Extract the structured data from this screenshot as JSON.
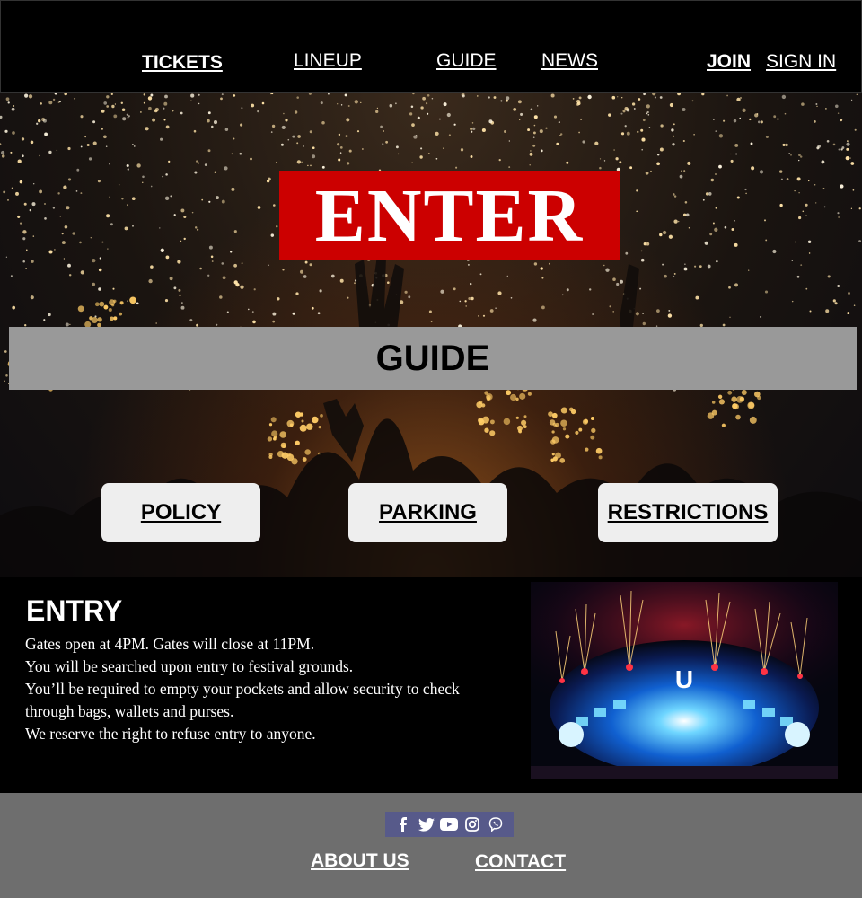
{
  "nav": {
    "tickets": "TICKETS",
    "lineup": "LINEUP",
    "guide": "GUIDE",
    "news": "NEWS",
    "join": "JOIN",
    "sign_in": "SIGN IN"
  },
  "hero": {
    "logo_text": "ENTER",
    "banner_title": "GUIDE",
    "buttons": {
      "policy": "POLICY",
      "parking": "PARKING",
      "restrictions": "RESTRICTIONS"
    },
    "background": "concert-crowd-lights-photo"
  },
  "entry": {
    "title": "ENTRY",
    "lines": [
      "Gates open at 4PM. Gates will close at 11PM.",
      "You will be searched upon entry to festival grounds.",
      "You’ll be required to empty your pockets and allow security to check through bags, wallets and purses.",
      "We reserve the right to refuse entry to anyone."
    ],
    "image": "festival-stage-fireworks-photo"
  },
  "footer": {
    "social_icons": [
      "facebook-icon",
      "twitter-icon",
      "youtube-icon",
      "instagram-icon",
      "viber-icon"
    ],
    "about_us": "ABOUT US",
    "contact": "CONTACT"
  },
  "colors": {
    "logo_red": "#cc0000",
    "banner_gray": "#999999",
    "footer_gray": "#6e6e6e",
    "social_bar": "#575a8a"
  }
}
